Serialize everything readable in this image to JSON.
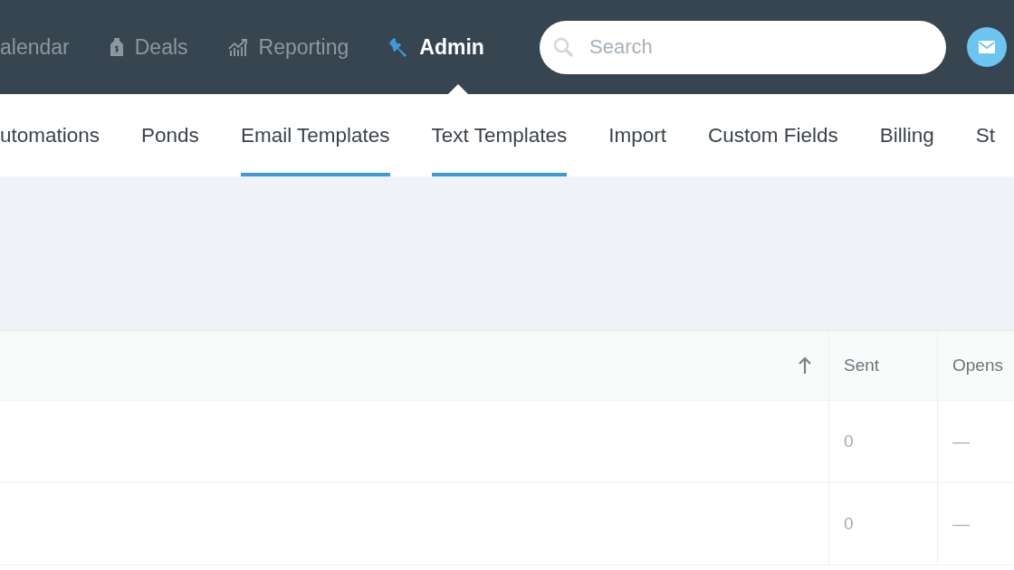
{
  "top_nav": {
    "items": [
      {
        "label": "alendar",
        "selected": false
      },
      {
        "label": "Deals",
        "selected": false
      },
      {
        "label": "Reporting",
        "selected": false
      },
      {
        "label": "Admin",
        "selected": true
      }
    ],
    "search": {
      "placeholder": "Search"
    }
  },
  "sub_nav": {
    "tabs": [
      {
        "label": "utomations",
        "selected": false
      },
      {
        "label": "Ponds",
        "selected": false
      },
      {
        "label": "Email Templates",
        "selected": true
      },
      {
        "label": "Text Templates",
        "selected": true
      },
      {
        "label": "Import",
        "selected": false
      },
      {
        "label": "Custom Fields",
        "selected": false
      },
      {
        "label": "Billing",
        "selected": false
      },
      {
        "label": "St",
        "selected": false
      }
    ]
  },
  "table": {
    "columns": [
      {
        "kind": "sort"
      },
      {
        "kind": "text",
        "label": "Sent"
      },
      {
        "kind": "text",
        "label": "Opens"
      }
    ],
    "rows": [
      {
        "sent": "0",
        "opens": "—"
      },
      {
        "sent": "0",
        "opens": "—"
      }
    ]
  }
}
